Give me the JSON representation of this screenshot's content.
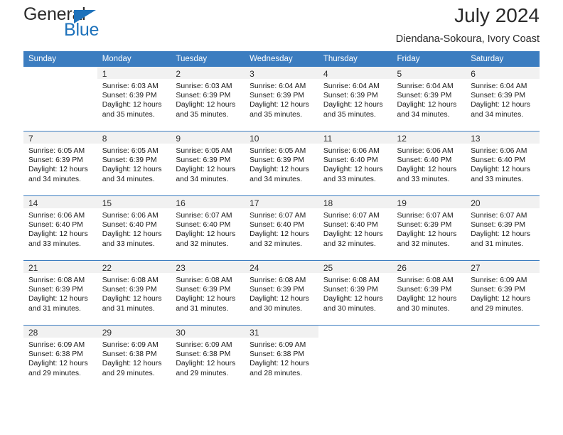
{
  "brand": {
    "name_top": "General",
    "name_bottom": "Blue",
    "accent_color": "#1e72bb"
  },
  "header": {
    "title": "July 2024",
    "subtitle": "Diendana-Sokoura, Ivory Coast"
  },
  "calendar": {
    "header_bg": "#3c7dc0",
    "daynum_band_bg": "#f1f1f1",
    "weekday_headers": [
      "Sunday",
      "Monday",
      "Tuesday",
      "Wednesday",
      "Thursday",
      "Friday",
      "Saturday"
    ],
    "weeks": [
      [
        {
          "day": "",
          "sunrise": "",
          "sunset": "",
          "daylight_line1": "",
          "daylight_line2": ""
        },
        {
          "day": "1",
          "sunrise": "Sunrise: 6:03 AM",
          "sunset": "Sunset: 6:39 PM",
          "daylight_line1": "Daylight: 12 hours",
          "daylight_line2": "and 35 minutes."
        },
        {
          "day": "2",
          "sunrise": "Sunrise: 6:03 AM",
          "sunset": "Sunset: 6:39 PM",
          "daylight_line1": "Daylight: 12 hours",
          "daylight_line2": "and 35 minutes."
        },
        {
          "day": "3",
          "sunrise": "Sunrise: 6:04 AM",
          "sunset": "Sunset: 6:39 PM",
          "daylight_line1": "Daylight: 12 hours",
          "daylight_line2": "and 35 minutes."
        },
        {
          "day": "4",
          "sunrise": "Sunrise: 6:04 AM",
          "sunset": "Sunset: 6:39 PM",
          "daylight_line1": "Daylight: 12 hours",
          "daylight_line2": "and 35 minutes."
        },
        {
          "day": "5",
          "sunrise": "Sunrise: 6:04 AM",
          "sunset": "Sunset: 6:39 PM",
          "daylight_line1": "Daylight: 12 hours",
          "daylight_line2": "and 34 minutes."
        },
        {
          "day": "6",
          "sunrise": "Sunrise: 6:04 AM",
          "sunset": "Sunset: 6:39 PM",
          "daylight_line1": "Daylight: 12 hours",
          "daylight_line2": "and 34 minutes."
        }
      ],
      [
        {
          "day": "7",
          "sunrise": "Sunrise: 6:05 AM",
          "sunset": "Sunset: 6:39 PM",
          "daylight_line1": "Daylight: 12 hours",
          "daylight_line2": "and 34 minutes."
        },
        {
          "day": "8",
          "sunrise": "Sunrise: 6:05 AM",
          "sunset": "Sunset: 6:39 PM",
          "daylight_line1": "Daylight: 12 hours",
          "daylight_line2": "and 34 minutes."
        },
        {
          "day": "9",
          "sunrise": "Sunrise: 6:05 AM",
          "sunset": "Sunset: 6:39 PM",
          "daylight_line1": "Daylight: 12 hours",
          "daylight_line2": "and 34 minutes."
        },
        {
          "day": "10",
          "sunrise": "Sunrise: 6:05 AM",
          "sunset": "Sunset: 6:39 PM",
          "daylight_line1": "Daylight: 12 hours",
          "daylight_line2": "and 34 minutes."
        },
        {
          "day": "11",
          "sunrise": "Sunrise: 6:06 AM",
          "sunset": "Sunset: 6:40 PM",
          "daylight_line1": "Daylight: 12 hours",
          "daylight_line2": "and 33 minutes."
        },
        {
          "day": "12",
          "sunrise": "Sunrise: 6:06 AM",
          "sunset": "Sunset: 6:40 PM",
          "daylight_line1": "Daylight: 12 hours",
          "daylight_line2": "and 33 minutes."
        },
        {
          "day": "13",
          "sunrise": "Sunrise: 6:06 AM",
          "sunset": "Sunset: 6:40 PM",
          "daylight_line1": "Daylight: 12 hours",
          "daylight_line2": "and 33 minutes."
        }
      ],
      [
        {
          "day": "14",
          "sunrise": "Sunrise: 6:06 AM",
          "sunset": "Sunset: 6:40 PM",
          "daylight_line1": "Daylight: 12 hours",
          "daylight_line2": "and 33 minutes."
        },
        {
          "day": "15",
          "sunrise": "Sunrise: 6:06 AM",
          "sunset": "Sunset: 6:40 PM",
          "daylight_line1": "Daylight: 12 hours",
          "daylight_line2": "and 33 minutes."
        },
        {
          "day": "16",
          "sunrise": "Sunrise: 6:07 AM",
          "sunset": "Sunset: 6:40 PM",
          "daylight_line1": "Daylight: 12 hours",
          "daylight_line2": "and 32 minutes."
        },
        {
          "day": "17",
          "sunrise": "Sunrise: 6:07 AM",
          "sunset": "Sunset: 6:40 PM",
          "daylight_line1": "Daylight: 12 hours",
          "daylight_line2": "and 32 minutes."
        },
        {
          "day": "18",
          "sunrise": "Sunrise: 6:07 AM",
          "sunset": "Sunset: 6:40 PM",
          "daylight_line1": "Daylight: 12 hours",
          "daylight_line2": "and 32 minutes."
        },
        {
          "day": "19",
          "sunrise": "Sunrise: 6:07 AM",
          "sunset": "Sunset: 6:39 PM",
          "daylight_line1": "Daylight: 12 hours",
          "daylight_line2": "and 32 minutes."
        },
        {
          "day": "20",
          "sunrise": "Sunrise: 6:07 AM",
          "sunset": "Sunset: 6:39 PM",
          "daylight_line1": "Daylight: 12 hours",
          "daylight_line2": "and 31 minutes."
        }
      ],
      [
        {
          "day": "21",
          "sunrise": "Sunrise: 6:08 AM",
          "sunset": "Sunset: 6:39 PM",
          "daylight_line1": "Daylight: 12 hours",
          "daylight_line2": "and 31 minutes."
        },
        {
          "day": "22",
          "sunrise": "Sunrise: 6:08 AM",
          "sunset": "Sunset: 6:39 PM",
          "daylight_line1": "Daylight: 12 hours",
          "daylight_line2": "and 31 minutes."
        },
        {
          "day": "23",
          "sunrise": "Sunrise: 6:08 AM",
          "sunset": "Sunset: 6:39 PM",
          "daylight_line1": "Daylight: 12 hours",
          "daylight_line2": "and 31 minutes."
        },
        {
          "day": "24",
          "sunrise": "Sunrise: 6:08 AM",
          "sunset": "Sunset: 6:39 PM",
          "daylight_line1": "Daylight: 12 hours",
          "daylight_line2": "and 30 minutes."
        },
        {
          "day": "25",
          "sunrise": "Sunrise: 6:08 AM",
          "sunset": "Sunset: 6:39 PM",
          "daylight_line1": "Daylight: 12 hours",
          "daylight_line2": "and 30 minutes."
        },
        {
          "day": "26",
          "sunrise": "Sunrise: 6:08 AM",
          "sunset": "Sunset: 6:39 PM",
          "daylight_line1": "Daylight: 12 hours",
          "daylight_line2": "and 30 minutes."
        },
        {
          "day": "27",
          "sunrise": "Sunrise: 6:09 AM",
          "sunset": "Sunset: 6:39 PM",
          "daylight_line1": "Daylight: 12 hours",
          "daylight_line2": "and 29 minutes."
        }
      ],
      [
        {
          "day": "28",
          "sunrise": "Sunrise: 6:09 AM",
          "sunset": "Sunset: 6:38 PM",
          "daylight_line1": "Daylight: 12 hours",
          "daylight_line2": "and 29 minutes."
        },
        {
          "day": "29",
          "sunrise": "Sunrise: 6:09 AM",
          "sunset": "Sunset: 6:38 PM",
          "daylight_line1": "Daylight: 12 hours",
          "daylight_line2": "and 29 minutes."
        },
        {
          "day": "30",
          "sunrise": "Sunrise: 6:09 AM",
          "sunset": "Sunset: 6:38 PM",
          "daylight_line1": "Daylight: 12 hours",
          "daylight_line2": "and 29 minutes."
        },
        {
          "day": "31",
          "sunrise": "Sunrise: 6:09 AM",
          "sunset": "Sunset: 6:38 PM",
          "daylight_line1": "Daylight: 12 hours",
          "daylight_line2": "and 28 minutes."
        },
        {
          "day": "",
          "sunrise": "",
          "sunset": "",
          "daylight_line1": "",
          "daylight_line2": ""
        },
        {
          "day": "",
          "sunrise": "",
          "sunset": "",
          "daylight_line1": "",
          "daylight_line2": ""
        },
        {
          "day": "",
          "sunrise": "",
          "sunset": "",
          "daylight_line1": "",
          "daylight_line2": ""
        }
      ]
    ]
  }
}
